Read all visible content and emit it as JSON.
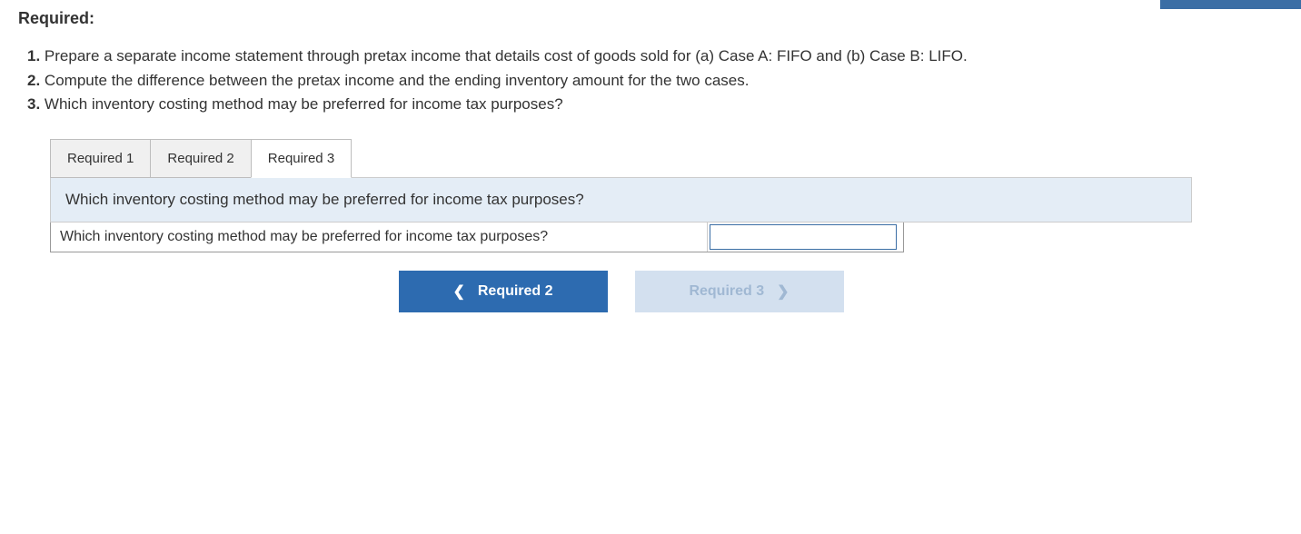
{
  "heading": "Required:",
  "requirements": [
    {
      "num": "1.",
      "text": "Prepare a separate income statement through pretax income that details cost of goods sold for (a) Case A: FIFO and (b) Case B: LIFO."
    },
    {
      "num": "2.",
      "text": "Compute the difference between the pretax income and the ending inventory amount for the two cases."
    },
    {
      "num": "3.",
      "text": "Which inventory costing method may be preferred for income tax purposes?"
    }
  ],
  "tabs": {
    "items": [
      {
        "label": "Required 1"
      },
      {
        "label": "Required 2"
      },
      {
        "label": "Required 3"
      }
    ],
    "active_index": 2
  },
  "question_banner": "Which inventory costing method may be preferred for income tax purposes?",
  "answer_row": {
    "label": "Which inventory costing method may be preferred for income tax purposes?",
    "input_value": ""
  },
  "nav": {
    "prev_label": "Required 2",
    "next_label": "Required 3"
  }
}
